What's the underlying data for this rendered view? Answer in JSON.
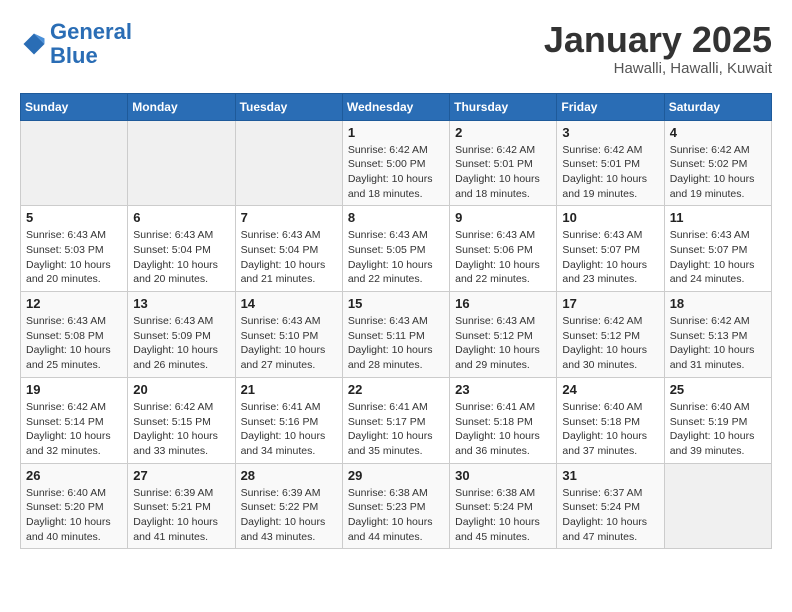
{
  "header": {
    "logo_line1": "General",
    "logo_line2": "Blue",
    "month_title": "January 2025",
    "location": "Hawalli, Hawalli, Kuwait"
  },
  "weekdays": [
    "Sunday",
    "Monday",
    "Tuesday",
    "Wednesday",
    "Thursday",
    "Friday",
    "Saturday"
  ],
  "weeks": [
    [
      {
        "day": "",
        "info": ""
      },
      {
        "day": "",
        "info": ""
      },
      {
        "day": "",
        "info": ""
      },
      {
        "day": "1",
        "info": "Sunrise: 6:42 AM\nSunset: 5:00 PM\nDaylight: 10 hours\nand 18 minutes."
      },
      {
        "day": "2",
        "info": "Sunrise: 6:42 AM\nSunset: 5:01 PM\nDaylight: 10 hours\nand 18 minutes."
      },
      {
        "day": "3",
        "info": "Sunrise: 6:42 AM\nSunset: 5:01 PM\nDaylight: 10 hours\nand 19 minutes."
      },
      {
        "day": "4",
        "info": "Sunrise: 6:42 AM\nSunset: 5:02 PM\nDaylight: 10 hours\nand 19 minutes."
      }
    ],
    [
      {
        "day": "5",
        "info": "Sunrise: 6:43 AM\nSunset: 5:03 PM\nDaylight: 10 hours\nand 20 minutes."
      },
      {
        "day": "6",
        "info": "Sunrise: 6:43 AM\nSunset: 5:04 PM\nDaylight: 10 hours\nand 20 minutes."
      },
      {
        "day": "7",
        "info": "Sunrise: 6:43 AM\nSunset: 5:04 PM\nDaylight: 10 hours\nand 21 minutes."
      },
      {
        "day": "8",
        "info": "Sunrise: 6:43 AM\nSunset: 5:05 PM\nDaylight: 10 hours\nand 22 minutes."
      },
      {
        "day": "9",
        "info": "Sunrise: 6:43 AM\nSunset: 5:06 PM\nDaylight: 10 hours\nand 22 minutes."
      },
      {
        "day": "10",
        "info": "Sunrise: 6:43 AM\nSunset: 5:07 PM\nDaylight: 10 hours\nand 23 minutes."
      },
      {
        "day": "11",
        "info": "Sunrise: 6:43 AM\nSunset: 5:07 PM\nDaylight: 10 hours\nand 24 minutes."
      }
    ],
    [
      {
        "day": "12",
        "info": "Sunrise: 6:43 AM\nSunset: 5:08 PM\nDaylight: 10 hours\nand 25 minutes."
      },
      {
        "day": "13",
        "info": "Sunrise: 6:43 AM\nSunset: 5:09 PM\nDaylight: 10 hours\nand 26 minutes."
      },
      {
        "day": "14",
        "info": "Sunrise: 6:43 AM\nSunset: 5:10 PM\nDaylight: 10 hours\nand 27 minutes."
      },
      {
        "day": "15",
        "info": "Sunrise: 6:43 AM\nSunset: 5:11 PM\nDaylight: 10 hours\nand 28 minutes."
      },
      {
        "day": "16",
        "info": "Sunrise: 6:43 AM\nSunset: 5:12 PM\nDaylight: 10 hours\nand 29 minutes."
      },
      {
        "day": "17",
        "info": "Sunrise: 6:42 AM\nSunset: 5:12 PM\nDaylight: 10 hours\nand 30 minutes."
      },
      {
        "day": "18",
        "info": "Sunrise: 6:42 AM\nSunset: 5:13 PM\nDaylight: 10 hours\nand 31 minutes."
      }
    ],
    [
      {
        "day": "19",
        "info": "Sunrise: 6:42 AM\nSunset: 5:14 PM\nDaylight: 10 hours\nand 32 minutes."
      },
      {
        "day": "20",
        "info": "Sunrise: 6:42 AM\nSunset: 5:15 PM\nDaylight: 10 hours\nand 33 minutes."
      },
      {
        "day": "21",
        "info": "Sunrise: 6:41 AM\nSunset: 5:16 PM\nDaylight: 10 hours\nand 34 minutes."
      },
      {
        "day": "22",
        "info": "Sunrise: 6:41 AM\nSunset: 5:17 PM\nDaylight: 10 hours\nand 35 minutes."
      },
      {
        "day": "23",
        "info": "Sunrise: 6:41 AM\nSunset: 5:18 PM\nDaylight: 10 hours\nand 36 minutes."
      },
      {
        "day": "24",
        "info": "Sunrise: 6:40 AM\nSunset: 5:18 PM\nDaylight: 10 hours\nand 37 minutes."
      },
      {
        "day": "25",
        "info": "Sunrise: 6:40 AM\nSunset: 5:19 PM\nDaylight: 10 hours\nand 39 minutes."
      }
    ],
    [
      {
        "day": "26",
        "info": "Sunrise: 6:40 AM\nSunset: 5:20 PM\nDaylight: 10 hours\nand 40 minutes."
      },
      {
        "day": "27",
        "info": "Sunrise: 6:39 AM\nSunset: 5:21 PM\nDaylight: 10 hours\nand 41 minutes."
      },
      {
        "day": "28",
        "info": "Sunrise: 6:39 AM\nSunset: 5:22 PM\nDaylight: 10 hours\nand 43 minutes."
      },
      {
        "day": "29",
        "info": "Sunrise: 6:38 AM\nSunset: 5:23 PM\nDaylight: 10 hours\nand 44 minutes."
      },
      {
        "day": "30",
        "info": "Sunrise: 6:38 AM\nSunset: 5:24 PM\nDaylight: 10 hours\nand 45 minutes."
      },
      {
        "day": "31",
        "info": "Sunrise: 6:37 AM\nSunset: 5:24 PM\nDaylight: 10 hours\nand 47 minutes."
      },
      {
        "day": "",
        "info": ""
      }
    ]
  ]
}
